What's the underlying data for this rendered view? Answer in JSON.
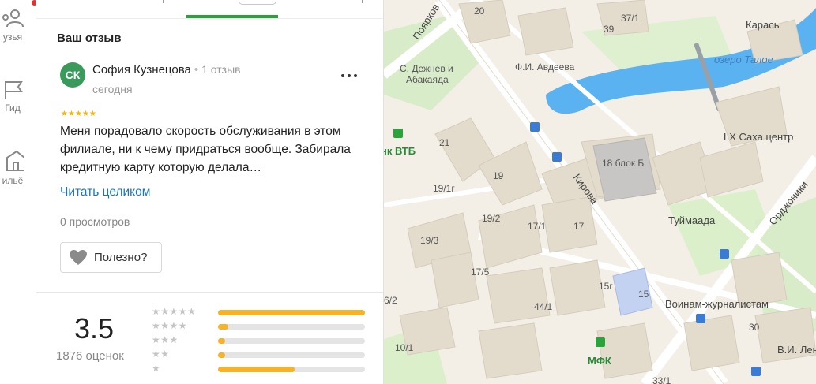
{
  "nav": {
    "items": [
      {
        "label": "узья",
        "icon": "friends-icon"
      },
      {
        "label": "Гид",
        "icon": "guide-icon"
      },
      {
        "label": "ильё",
        "icon": "housing-icon"
      }
    ]
  },
  "review": {
    "section_title": "Ваш отзыв",
    "avatar_initials": "СК",
    "author_name": "София Кузнецова",
    "author_reviews": "1 отзыв",
    "date": "сегодня",
    "rating_stars": 5,
    "text": "Меня порадовало скорость обслуживания в этом филиале, ни к чему придраться вообще. Забирала кредитную карту которую делала…",
    "read_more": "Читать целиком",
    "views": "0 просмотров",
    "useful_label": "Полезно?"
  },
  "summary": {
    "rating": "3.5",
    "count_label": "1876 оценок",
    "distribution": [
      {
        "stars": 5,
        "fraction": 1.0
      },
      {
        "stars": 4,
        "fraction": 0.07
      },
      {
        "stars": 3,
        "fraction": 0.05
      },
      {
        "stars": 2,
        "fraction": 0.05
      },
      {
        "stars": 1,
        "fraction": 0.52
      }
    ]
  },
  "map": {
    "labels": [
      {
        "text": "Поярков",
        "cls": "lg"
      },
      {
        "text": "20",
        "cls": ""
      },
      {
        "text": "37/1",
        "cls": ""
      },
      {
        "text": "39",
        "cls": ""
      },
      {
        "text": "Карась",
        "cls": "lg"
      },
      {
        "text": "озеро Талое",
        "cls": "lake"
      },
      {
        "text": "С. Дежнев и",
        "cls": ""
      },
      {
        "text": "Абакаяда",
        "cls": ""
      },
      {
        "text": "Ф.И. Авдеева",
        "cls": ""
      },
      {
        "text": "нк ВТБ",
        "cls": "green"
      },
      {
        "text": "21",
        "cls": ""
      },
      {
        "text": "18 блок Б",
        "cls": ""
      },
      {
        "text": "LX Саха центр",
        "cls": "lg"
      },
      {
        "text": "19",
        "cls": ""
      },
      {
        "text": "Кирова",
        "cls": "lg"
      },
      {
        "text": "19/1г",
        "cls": ""
      },
      {
        "text": "Орджоники",
        "cls": "lg"
      },
      {
        "text": "19/2",
        "cls": ""
      },
      {
        "text": "17/1",
        "cls": ""
      },
      {
        "text": "17",
        "cls": ""
      },
      {
        "text": "Туймаада",
        "cls": "lg"
      },
      {
        "text": "19/3",
        "cls": ""
      },
      {
        "text": "17/5",
        "cls": ""
      },
      {
        "text": "15г",
        "cls": ""
      },
      {
        "text": "15",
        "cls": ""
      },
      {
        "text": "Воинам-журналистам",
        "cls": "lg"
      },
      {
        "text": "6/2",
        "cls": ""
      },
      {
        "text": "44/1",
        "cls": ""
      },
      {
        "text": "30",
        "cls": ""
      },
      {
        "text": "10/1",
        "cls": ""
      },
      {
        "text": "МФК",
        "cls": "green"
      },
      {
        "text": "В.И. Лен",
        "cls": "lg"
      },
      {
        "text": "33/1",
        "cls": ""
      }
    ]
  },
  "colors": {
    "accent_green": "#2aa33b",
    "star_yellow": "#f6b700",
    "bar_yellow": "#f6b22a",
    "link_blue": "#1a73c4",
    "lake_blue": "#5ab3f0",
    "avatar_green": "#3a9a5b"
  }
}
